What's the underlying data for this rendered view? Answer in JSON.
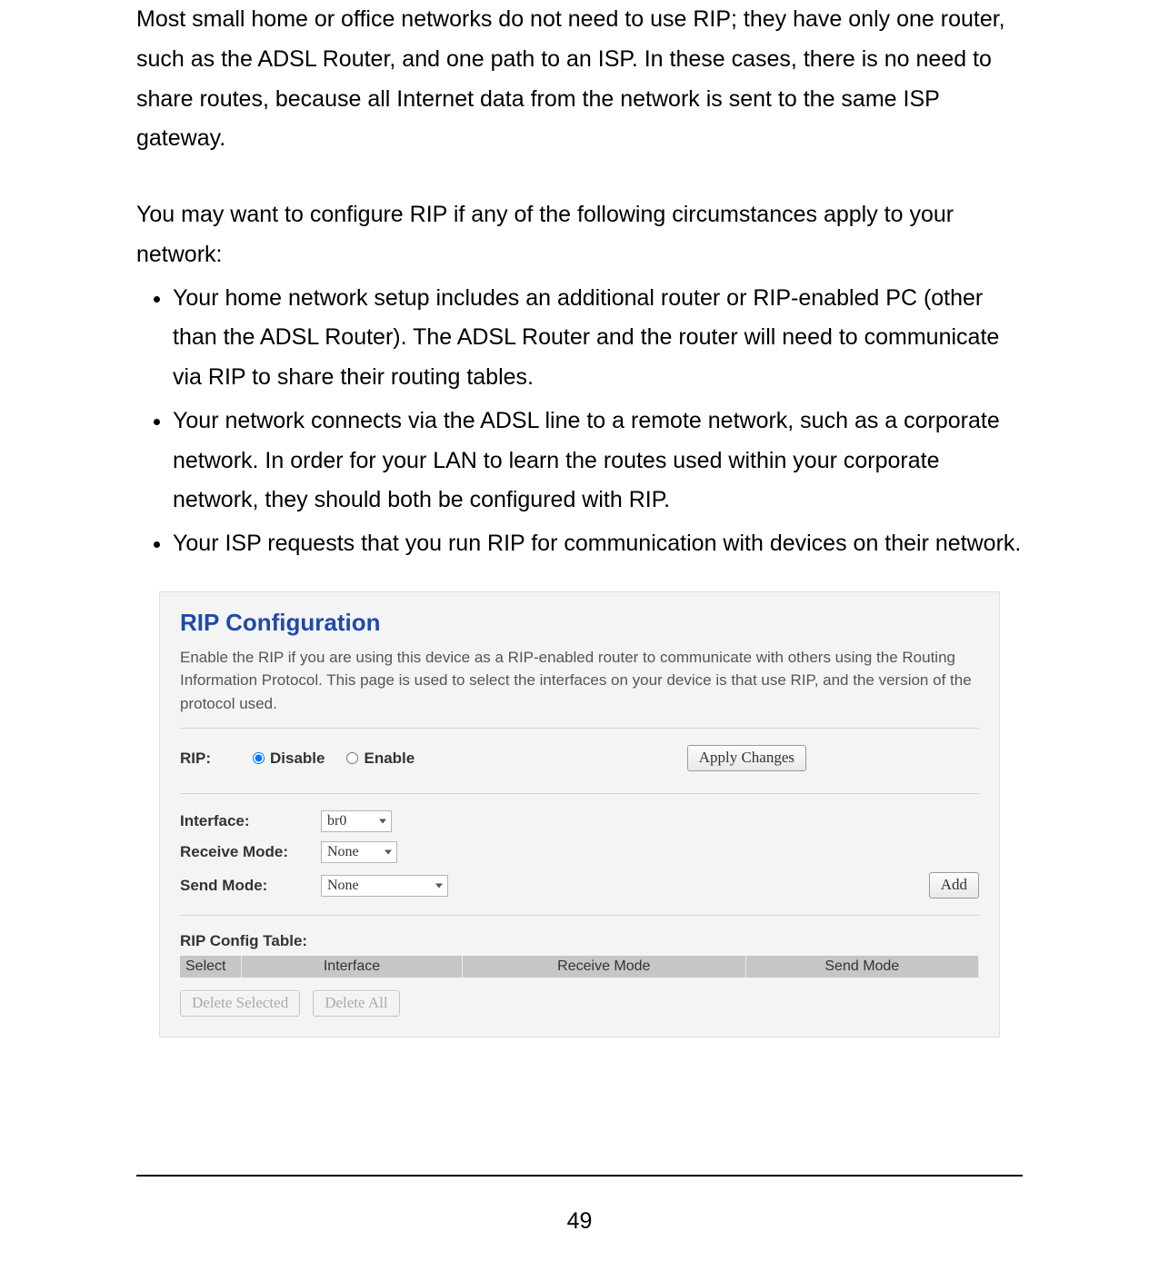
{
  "doc": {
    "para1": "Most small home or office networks do not need to use RIP; they have only one router, such as the ADSL Router, and one path to an ISP. In these cases, there is no need to share routes, because all Internet data from the network is sent to the same ISP gateway.",
    "para2": "You may want to configure RIP if any of the following circumstances apply to your network:",
    "bullets": [
      "Your home network setup includes an additional router or RIP-enabled PC (other than the ADSL Router). The ADSL Router and the router will need to communicate via RIP to share their routing tables.",
      "Your network connects via the ADSL line to a remote network, such as a corporate network. In order for your LAN to learn the routes used within your corporate network, they should both be configured with RIP.",
      "Your ISP requests that you run RIP for communication with devices on their network."
    ],
    "page_number": "49"
  },
  "panel": {
    "title": "RIP Configuration",
    "desc": "Enable the RIP if you are using this device as a RIP-enabled router to communicate with others using the Routing Information Protocol. This page is used to select the interfaces on your device is that use RIP, and the version of the protocol used.",
    "rip_label": "RIP:",
    "disable_label": "Disable",
    "enable_label": "Enable",
    "apply_label": "Apply Changes",
    "interface_label": "Interface:",
    "interface_value": "br0",
    "recv_label": "Receive Mode:",
    "recv_value": "None",
    "send_label": "Send Mode:",
    "send_value": "None",
    "add_label": "Add",
    "table_title": "RIP Config Table:",
    "cols": {
      "select": "Select",
      "interface": "Interface",
      "recv": "Receive Mode",
      "send": "Send Mode"
    },
    "delete_selected": "Delete Selected",
    "delete_all": "Delete All"
  }
}
